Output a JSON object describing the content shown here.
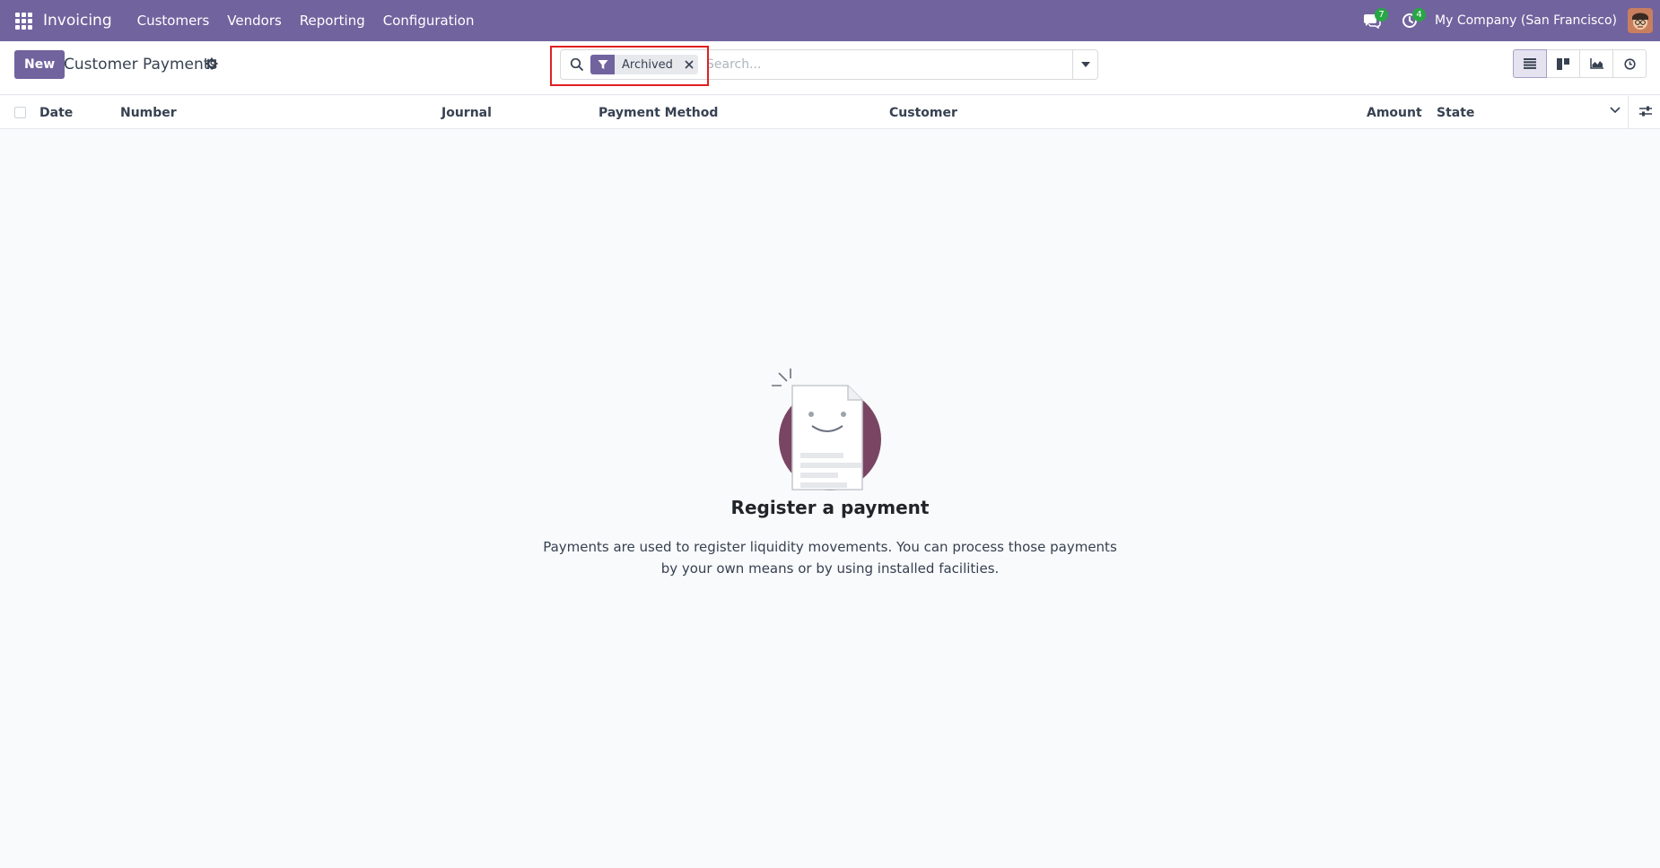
{
  "navbar": {
    "app_name": "Invoicing",
    "menu": [
      "Customers",
      "Vendors",
      "Reporting",
      "Configuration"
    ],
    "messages_count": "7",
    "activities_count": "4",
    "company": "My Company (San Francisco)",
    "accent_color": "#71639e"
  },
  "control_panel": {
    "new_label": "New",
    "title": "Customer Payments",
    "search": {
      "facet": "Archived",
      "placeholder": "Search..."
    }
  },
  "table": {
    "columns": [
      "Date",
      "Number",
      "Journal",
      "Payment Method",
      "Customer",
      "Amount",
      "State"
    ]
  },
  "empty_state": {
    "title": "Register a payment",
    "text_line1": "Payments are used to register liquidity movements. You can process those payments",
    "text_line2": "by your own means or by using installed facilities."
  }
}
